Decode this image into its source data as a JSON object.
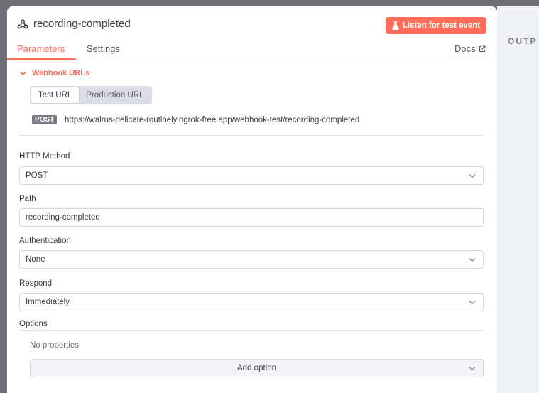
{
  "node": {
    "title": "recording-completed",
    "icon": "webhook-icon",
    "listen_button": "Listen for test event"
  },
  "tabs": [
    {
      "label": "Parameters",
      "active": true
    },
    {
      "label": "Settings",
      "active": false
    }
  ],
  "docs_label": "Docs",
  "output_label": "OUTP",
  "webhook_urls": {
    "section_label": "Webhook URLs",
    "segments": [
      {
        "label": "Test URL",
        "active": true
      },
      {
        "label": "Production URL",
        "active": false
      }
    ],
    "method_badge": "POST",
    "url": "https://walrus-delicate-routinely.ngrok-free.app/webhook-test/recording-completed"
  },
  "fields": {
    "http_method": {
      "label": "HTTP Method",
      "value": "POST"
    },
    "path": {
      "label": "Path",
      "value": "recording-completed"
    },
    "authentication": {
      "label": "Authentication",
      "value": "None"
    },
    "respond": {
      "label": "Respond",
      "value": "Immediately"
    }
  },
  "options": {
    "label": "Options",
    "empty_text": "No properties",
    "add_button": "Add option"
  },
  "colors": {
    "accent": "#ff6d5a",
    "badge": "#7b7b86"
  }
}
